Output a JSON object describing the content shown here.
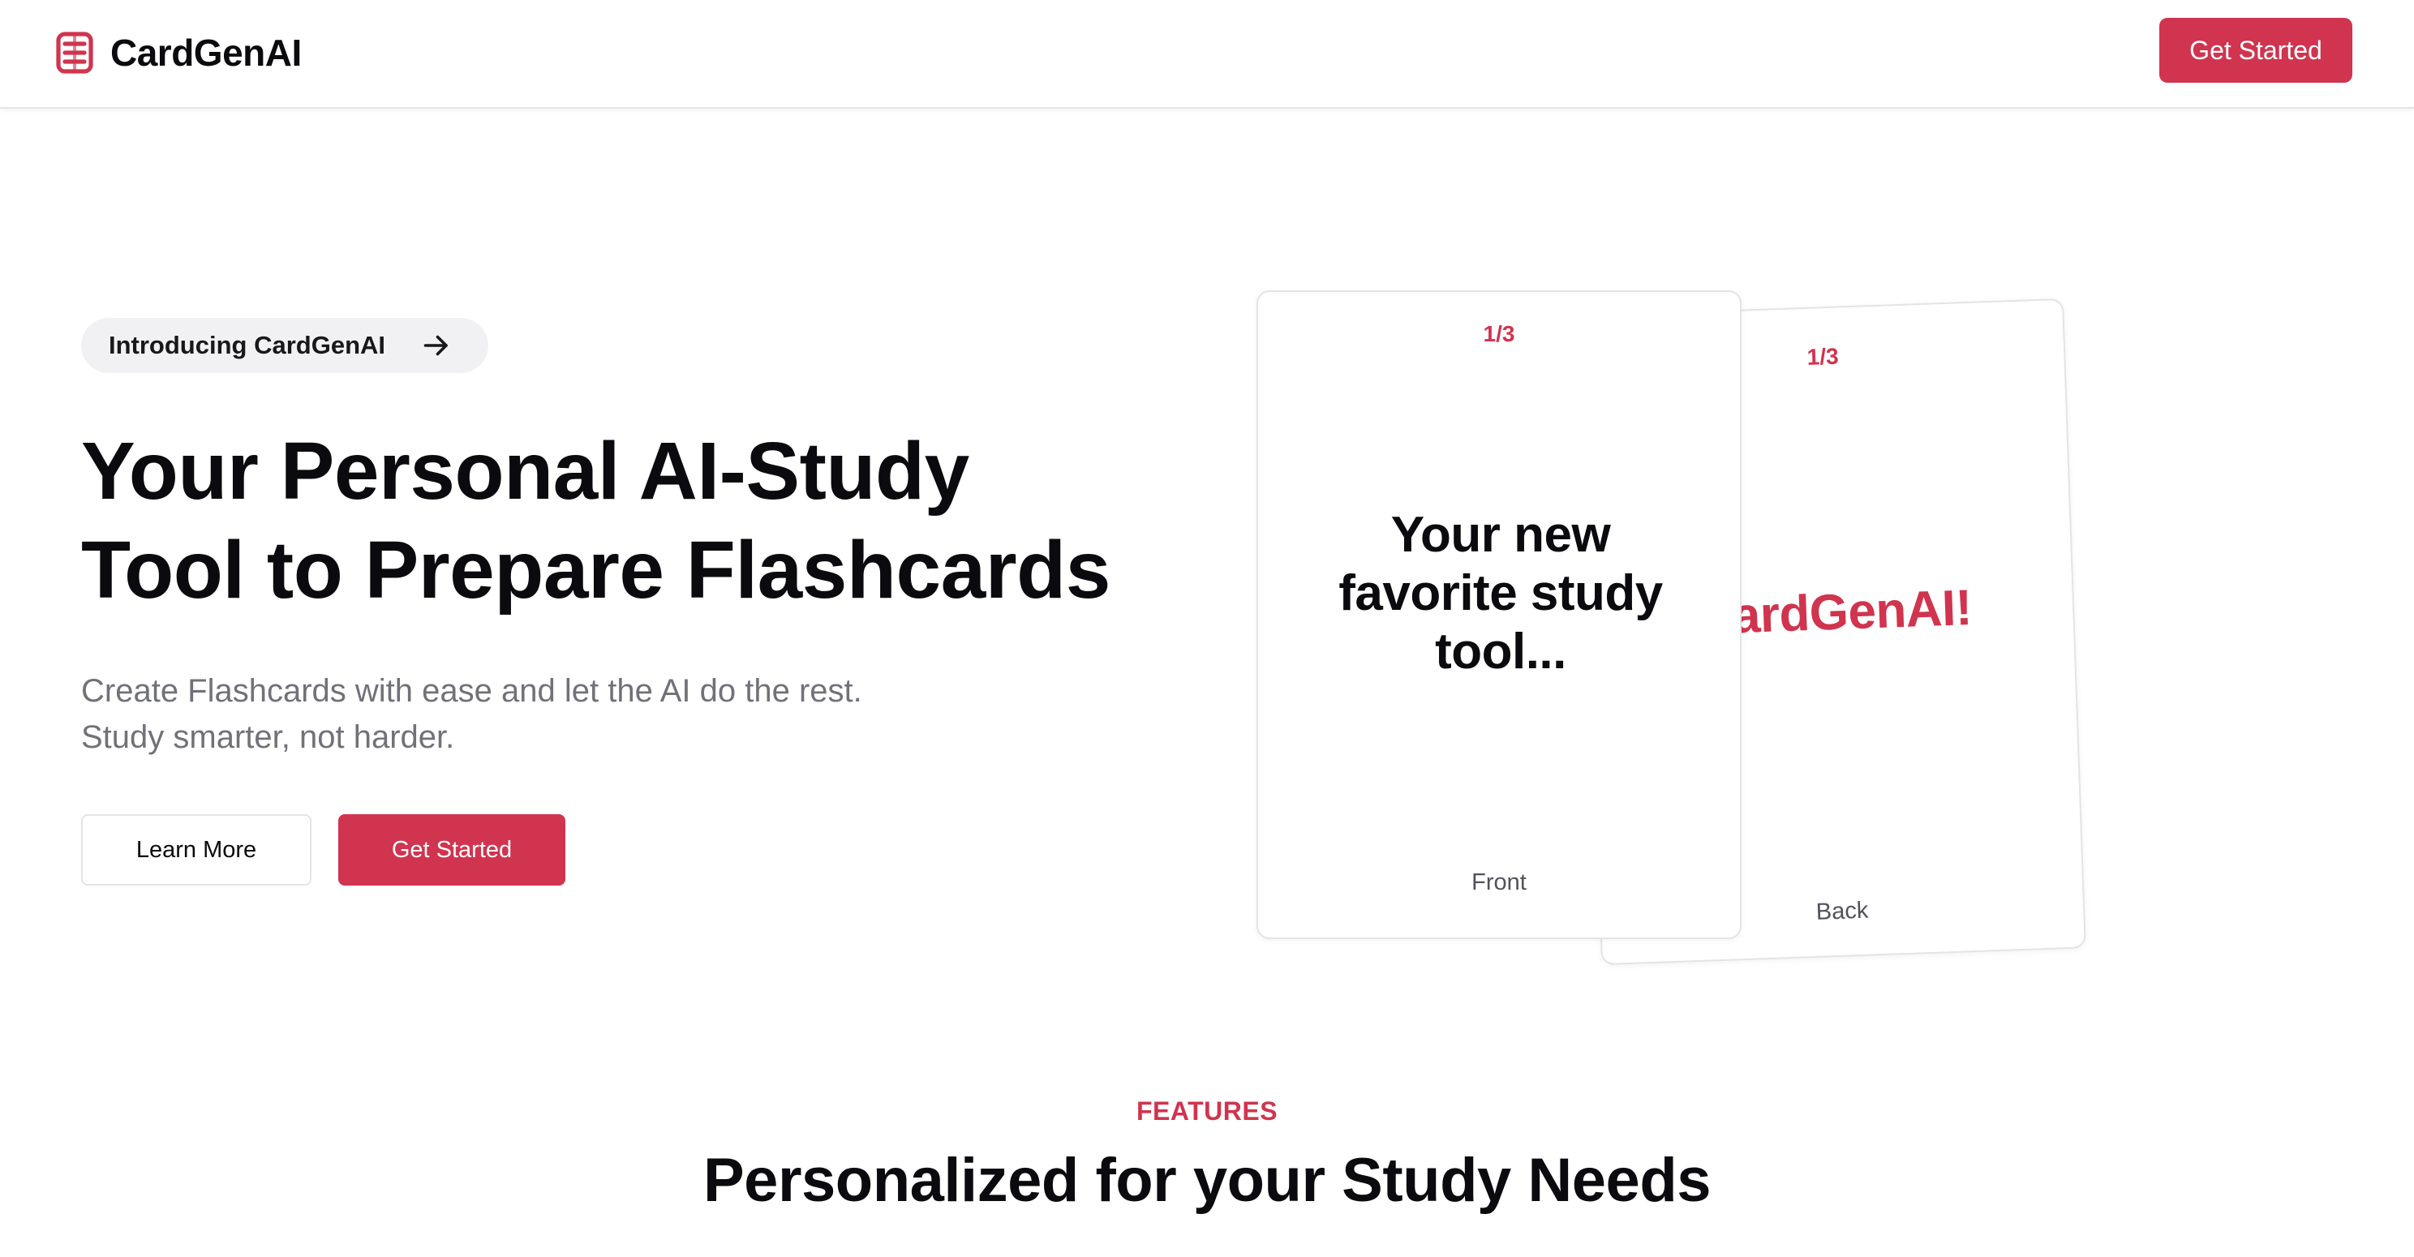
{
  "header": {
    "brand_name": "CardGenAI",
    "brand_icon": "cards-stack-icon",
    "cta_label": "Get Started"
  },
  "hero": {
    "pill_label": "Introducing CardGenAI",
    "pill_icon": "arrow-right-icon",
    "title_line1": "Your Personal AI-Study",
    "title_line2": "Tool to Prepare Flashcards",
    "subtitle_line1": "Create Flashcards with ease and let the AI do the rest.",
    "subtitle_line2": "Study smarter, not harder.",
    "learn_more_label": "Learn More",
    "get_started_label": "Get Started"
  },
  "cards": {
    "front": {
      "counter": "1/3",
      "text": "Your new favorite study tool...",
      "label": "Front"
    },
    "back": {
      "counter": "1/3",
      "text": "CardGenAI!",
      "label": "Back"
    }
  },
  "features": {
    "tag": "FEATURES",
    "title": "Personalized for your Study Needs"
  },
  "colors": {
    "accent": "#d0344f",
    "text": "#0b0b0f",
    "muted": "#71717a",
    "border": "#e4e4e7",
    "pill_bg": "#f1f1f3"
  }
}
